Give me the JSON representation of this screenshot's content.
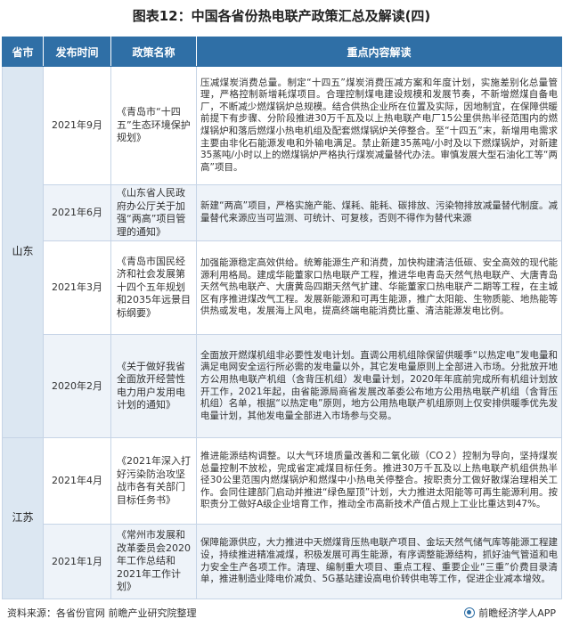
{
  "title": "图表12：中国各省份热电联产政策汇总及解读(四)",
  "headers": {
    "province": "省市",
    "date": "发布时间",
    "policy": "政策名称",
    "content": "重点内容解读"
  },
  "provinces": [
    "山东",
    "江苏"
  ],
  "rows": [
    {
      "date": "2021年9月",
      "policy": "《青岛市“十四五”生态环境保护规划》",
      "content": "压减煤炭消费总量。制定“十四五”煤炭消费压减方案和年度计划，实施差别化总量管理，严格控制新增耗煤项目。合理控制煤电建设规模和发展节奏，不新增燃煤自备电厂，不断减少燃煤锅炉总规模。结合供热企业所在位置及实际，因地制宜，在保障供暖前提下有步骤、分阶段推进30万千瓦及以上热电联产电厂15公里供热半径范围内的燃煤锅炉和落后燃煤小热电机组及配套燃煤锅炉关停整合。至“十四五”末，新增用电需求主要由非化石能源发电和外输电满足。禁止新建35蒸吨/小时及以下燃煤锅炉，对新建35蒸吨/小时以上的燃煤锅炉严格执行煤炭减量替代办法。审慎发展大型石油化工等“两高”项目。"
    },
    {
      "date": "2021年6月",
      "policy": "《山东省人民政府办公厅关于加强“两高”项目管理的通知》",
      "content": "新建“两高”项目，严格实施产能、煤耗、能耗、碳排放、污染物排放减量替代制度。减量替代来源应当可监测、可统计、可复核，否则不得作为替代来源"
    },
    {
      "date": "2021年3月",
      "policy": "《青岛市国民经济和社会发展第十四个五年规划和2035年远景目标纲要》",
      "content": "加强能源稳定高效供给。统筹能源生产和消费，加快构建清洁低碳、安全高效的现代能源利用格局。建成华能董家口热电联产工程，推进华电青岛天然气热电联产、大唐青岛天然气热电联产、大唐黄岛四期天然气扩建、华能董家口热电联产二期等工程，在主城区有序推进煤改气工程。发展新能源和可再生能源，推广太阳能、生物质能、地热能等供热或发电，发展海上风电，提高终端电能消费比重、清洁能源发电比例。"
    },
    {
      "date": "2020年2月",
      "policy": "《关于做好我省全面放开经营性电力用户发用电计划的通知》",
      "content": "全面放开燃煤机组非必要性发电计划。直调公用机组除保留供暖季“以热定电”发电量和满足电网安全运行所必需的发电量以外，其它发电量原则上全部进入市场。分批放开地方公用热电联产机组（含背压机组）发电量计划，2020年年底前完成所有机组计划放开工作，2021年起，由省能源局商省发展改革委公布地方公用热电联产机组（含背压机组）名单，根据“以热定电”原则，地方公用热电联产机组原则上仅安排供暖季优先发电量计划，其他发电量全部进入市场参与交易。"
    },
    {
      "date": "2021年4月",
      "policy": "《2021年深入打好污染防治攻坚战市各有关部门目标任务书》",
      "content": "推进能源结构调整。以大气环境质量改善和二氧化碳（CO２）控制为导向，坚持煤炭总量控制不放松，完成省定减煤目标任务。推进30万千瓦及以上热电联产机组供热半径30公里范围内燃煤锅炉和燃煤中小热电关停整合。按职责分工做好散煤治理相关工作。会同住建部门启动并推进“绿色屋顶”计划，大力推进太阳能等可再生能源利用。按职责分工做好A级企业培育工作，推动全市高新技术产值占规上工业比重达到47%。"
    },
    {
      "date": "2021年1月",
      "policy": "《常州市发展和改革委员会2020年工作总结和2021年工作计划》",
      "content": "保障能源供应，大力推进中天燃煤背压热电联产项目、金坛天然气储气库等能源工程建设，持续推进精准减煤，积极发展可再生能源，有序调整能源结构，抓好油气管道和电力安全生产各项工作。清理、编制重大项目、重点工程、重要企业“三重”价费目录清单，推进制造业降电价减负、5G基站建设高电价转供电等工作，促进企业减本增效。"
    }
  ],
  "footer": {
    "source": "资料来源：各省份官网 前瞻产业研究院整理",
    "brand": "前瞻经济学人APP"
  },
  "colors": {
    "header_bg": "#2f6fa6",
    "province_bg": "#dce7f2",
    "row_alt_bg": "#eef3f9",
    "border": "#c6d4e6"
  }
}
